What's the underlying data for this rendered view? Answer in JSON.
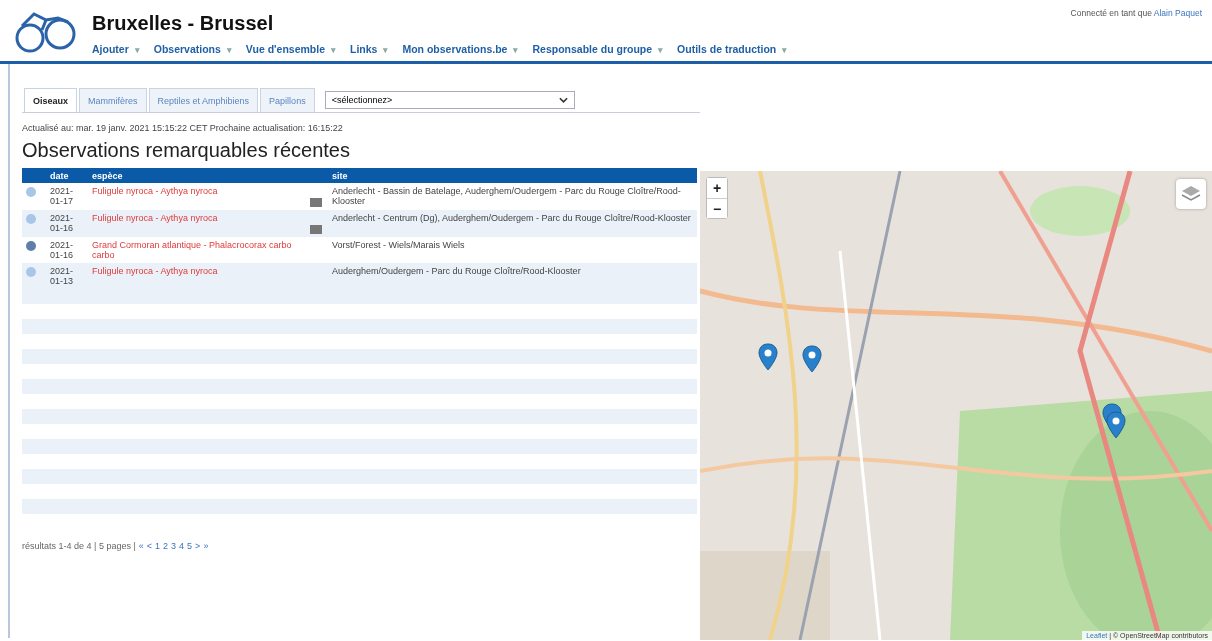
{
  "header": {
    "title": "Bruxelles - Brussel",
    "login_text": "Connecté en tant que",
    "login_user": "Alain Paquet"
  },
  "nav": [
    {
      "label": "Ajouter",
      "caret": "▾"
    },
    {
      "label": "Observations",
      "caret": "▾"
    },
    {
      "label": "Vue d'ensemble",
      "caret": "▾"
    },
    {
      "label": "Links",
      "caret": "▾"
    },
    {
      "label": "Mon observations.be",
      "caret": "▾"
    },
    {
      "label": "Responsable du groupe",
      "caret": "▾"
    },
    {
      "label": "Outils de traduction",
      "caret": "▾"
    }
  ],
  "tabs": [
    {
      "label": "Oiseaux",
      "selected": true
    },
    {
      "label": "Mammifères",
      "selected": false
    },
    {
      "label": "Reptiles et Amphibiens",
      "selected": false
    },
    {
      "label": "Papillons",
      "selected": false
    }
  ],
  "select": {
    "value": "<sélectionnez>"
  },
  "updated": "Actualisé au: mar. 19 janv. 2021 15:15:22 CET Prochaine actualisation: 16:15:22",
  "heading": "Observations remarquables récentes",
  "table": {
    "columns": [
      "date",
      "espèce",
      "site"
    ],
    "rows": [
      {
        "color": "#a9c6e8",
        "date": "2021-01-17",
        "species": "Fuligule nyroca - Aythya nyroca",
        "has_photo": true,
        "site": "Anderlecht - Bassin de Batelage, Auderghem/Oudergem - Parc du Rouge Cloître/Rood-Klooster"
      },
      {
        "color": "#a9c6e8",
        "date": "2021-01-16",
        "species": "Fuligule nyroca - Aythya nyroca",
        "has_photo": true,
        "site": "Anderlecht - Centrum (Dg), Auderghem/Oudergem - Parc du Rouge Cloître/Rood-Klooster"
      },
      {
        "color": "#5f7fa8",
        "date": "2021-01-16",
        "species": "Grand Cormoran atlantique - Phalacrocorax carbo carbo",
        "has_photo": false,
        "site": "Vorst/Forest - Wiels/Marais Wiels"
      },
      {
        "color": "#a9c6e8",
        "date": "2021-01-13",
        "species": "Fuligule nyroca - Aythya nyroca",
        "has_photo": false,
        "site": "Auderghem/Oudergem - Parc du Rouge Cloître/Rood-Klooster"
      }
    ]
  },
  "pagination": {
    "summary": "résultats 1-4 de 4 | 5 pages |",
    "links": [
      "«",
      "<",
      "1",
      "2",
      "3",
      "4",
      "5",
      ">",
      "»"
    ]
  },
  "map": {
    "zoom_in": "+",
    "zoom_out": "−",
    "attribution_link": "Leaflet",
    "attribution": "| © OpenStreetMap contributors"
  }
}
